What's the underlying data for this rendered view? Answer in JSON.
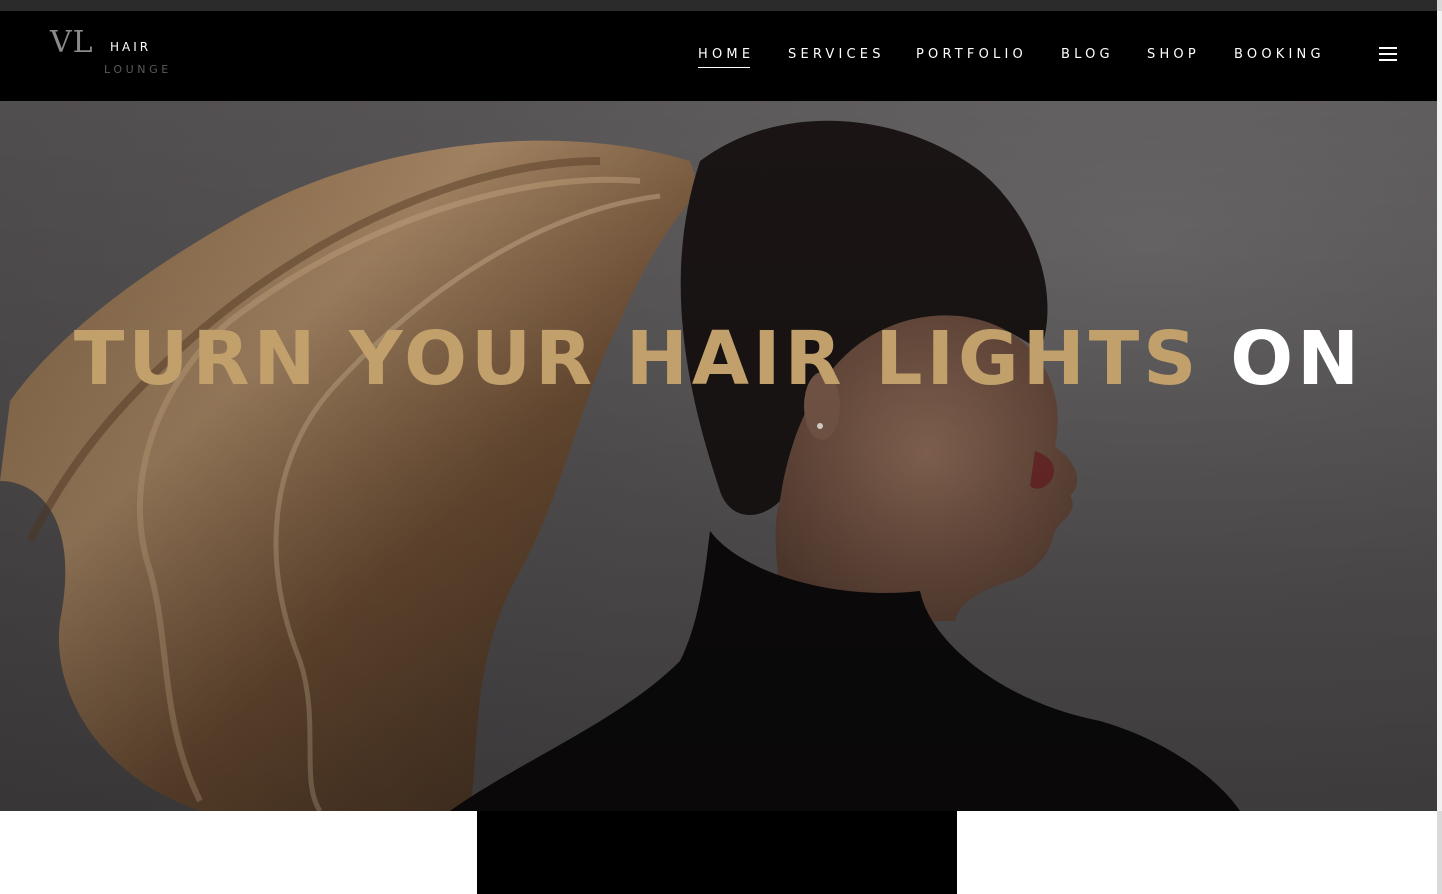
{
  "brand": {
    "mark": "VL",
    "line1": "HAIR",
    "line2": "LOUNGE"
  },
  "nav": {
    "items": [
      {
        "label": "HOME",
        "active": true
      },
      {
        "label": "SERVICES",
        "active": false
      },
      {
        "label": "PORTFOLIO",
        "active": false
      },
      {
        "label": "BLOG",
        "active": false
      },
      {
        "label": "SHOP",
        "active": false
      },
      {
        "label": "BOOKING",
        "active": false
      }
    ],
    "menu_icon": "hamburger-menu-icon"
  },
  "hero": {
    "headline_gold": "TURN YOUR HAIR LIGHTS",
    "headline_white": "ON",
    "accent_color": "#c1a06b"
  }
}
